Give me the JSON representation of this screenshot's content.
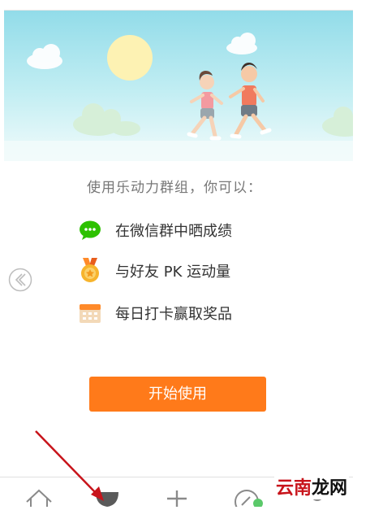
{
  "intro_text": "使用乐动力群组，你可以：",
  "features": [
    {
      "icon": "wechat-chat-icon",
      "label": "在微信群中晒成绩"
    },
    {
      "icon": "medal-icon",
      "label": "与好友 PK 运动量"
    },
    {
      "icon": "calendar-icon",
      "label": "每日打卡赢取奖品"
    }
  ],
  "start_button_label": "开始使用",
  "tabbar": {
    "items": [
      "home-icon",
      "trophy-icon",
      "add-icon",
      "compass-icon",
      "profile-icon"
    ]
  },
  "watermark": {
    "part1": "云南",
    "part2": "龙网"
  },
  "colors": {
    "accent": "#ff7a1a",
    "sky": "#a8e4ee",
    "wechat_green": "#2dc100",
    "annotation_arrow": "#c8141b"
  }
}
